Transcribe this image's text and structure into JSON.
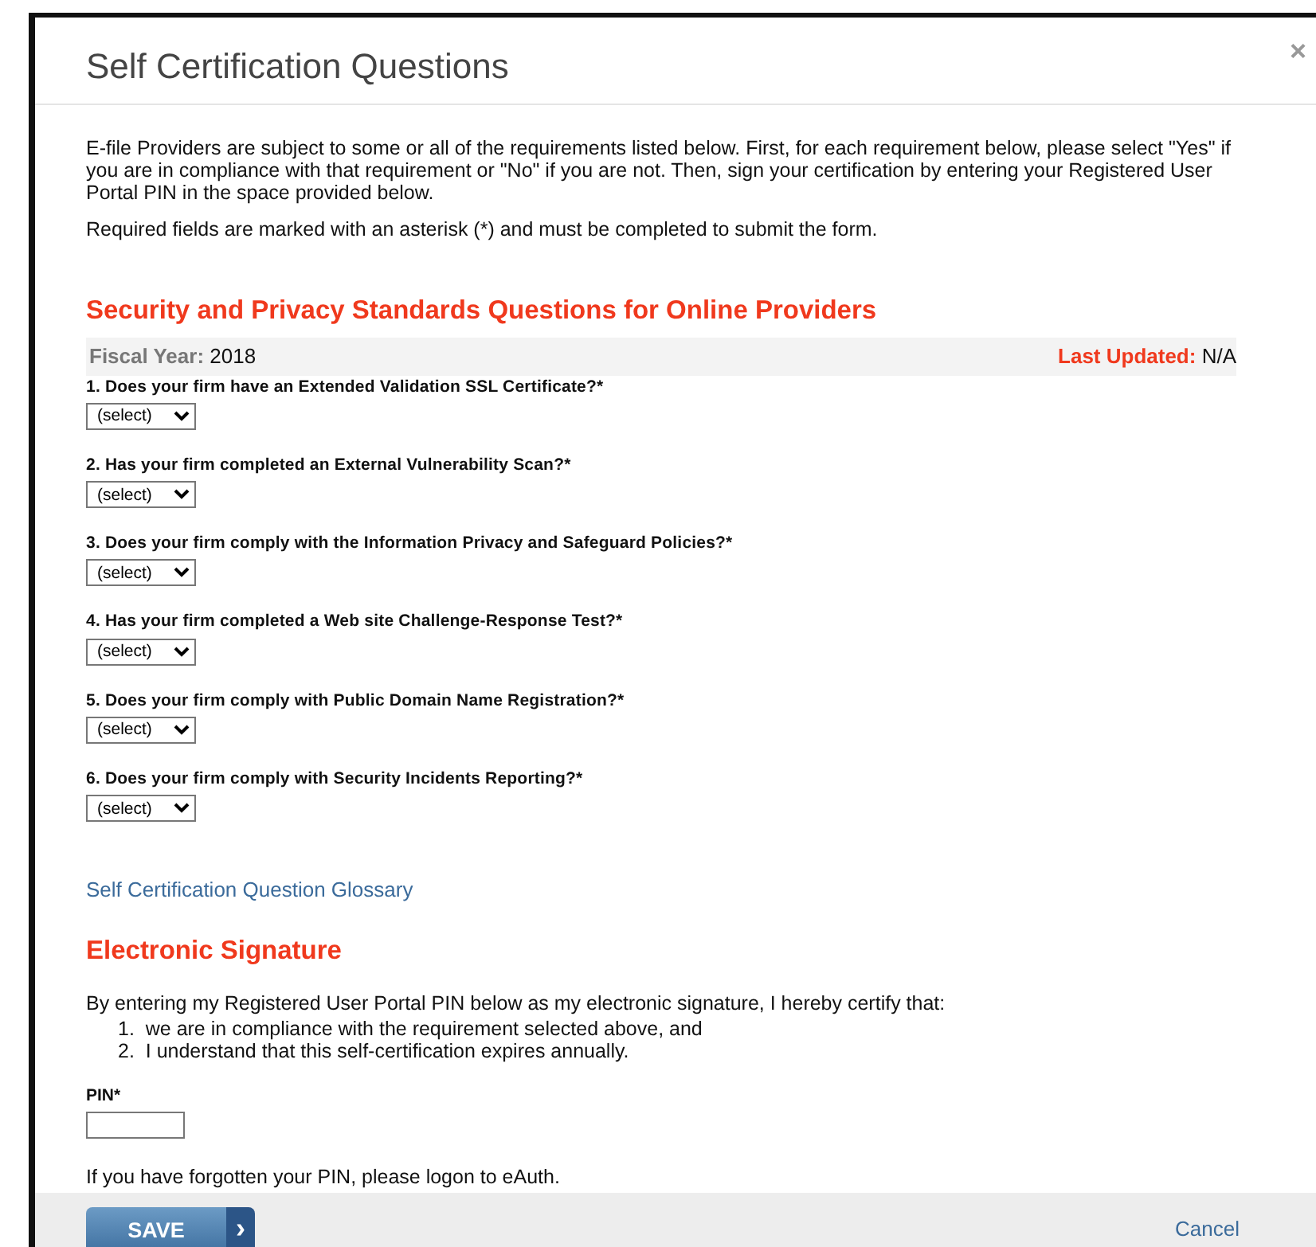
{
  "dialog": {
    "title": "Self Certification Questions",
    "close": "×"
  },
  "intro": [
    "E-file Providers are subject to some or all of the requirements listed below. First, for each requirement below, please select \"Yes\" if you are in compliance with that requirement or \"No\" if you are not. Then, sign your certification by entering your Registered User Portal PIN in the space provided below.",
    "Required fields are marked with an asterisk (*) and must be completed to submit the form."
  ],
  "section": {
    "heading": "Security and Privacy Standards Questions for Online Providers",
    "fiscal_year_label": "Fiscal Year:",
    "fiscal_year": "2018",
    "updated_label": "Last Updated:",
    "updated": "N/A"
  },
  "questions": [
    {
      "label": "1. Does your firm have an Extended Validation SSL Certificate?*",
      "value": "(select)"
    },
    {
      "label": "2. Has your firm completed an External Vulnerability Scan?*",
      "value": "(select)"
    },
    {
      "label": "3. Does your firm comply with the Information Privacy and Safeguard Policies?*",
      "value": "(select)"
    },
    {
      "label": "4. Has your firm completed a Web site Challenge-Response Test?*",
      "value": "(select)"
    },
    {
      "label": "5. Does your firm comply with Public Domain Name Registration?*",
      "value": "(select)"
    },
    {
      "label": "6. Does your firm comply with Security Incidents Reporting?*",
      "value": "(select)"
    }
  ],
  "glossary_link": "Self Certification Question Glossary",
  "signature": {
    "heading": "Electronic Signature",
    "statement": "By entering my Registered User Portal PIN below as my electronic signature, I hereby certify that:",
    "items": [
      {
        "number": "1.",
        "text": "we are in compliance with the requirement selected above, and"
      },
      {
        "number": "2.",
        "text": "I understand that this self-certification expires annually."
      }
    ],
    "pin_label": "PIN*",
    "forgot": "If you have forgotten your PIN, please logon to eAuth."
  },
  "footer": {
    "save": "SAVE",
    "save_chevron": "›",
    "cancel": "Cancel"
  }
}
